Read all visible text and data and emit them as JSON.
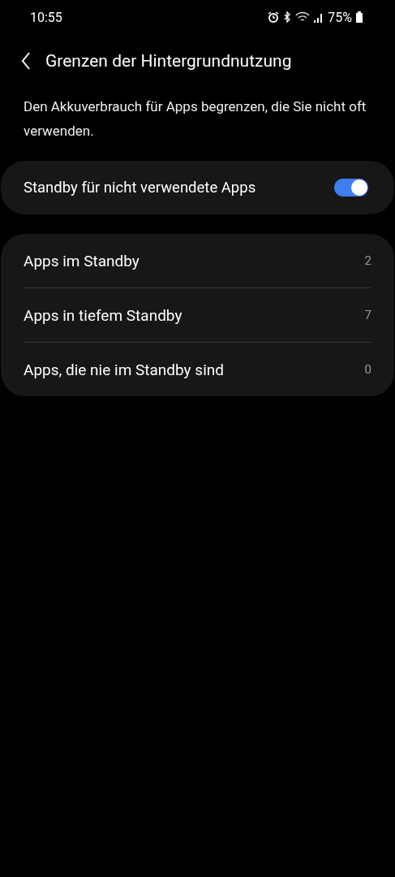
{
  "status_bar": {
    "time": "10:55",
    "battery": "75%"
  },
  "header": {
    "title": "Grenzen der Hintergrundnutzung"
  },
  "description": "Den Akkuverbrauch für Apps begrenzen, die Sie nicht oft verwenden.",
  "standby_switch": {
    "label": "Standby für nicht verwendete Apps",
    "on": true
  },
  "lists": [
    {
      "label": "Apps im Standby",
      "count": "2"
    },
    {
      "label": "Apps in tiefem Standby",
      "count": "7"
    },
    {
      "label": "Apps, die nie im Standby sind",
      "count": "0"
    }
  ]
}
